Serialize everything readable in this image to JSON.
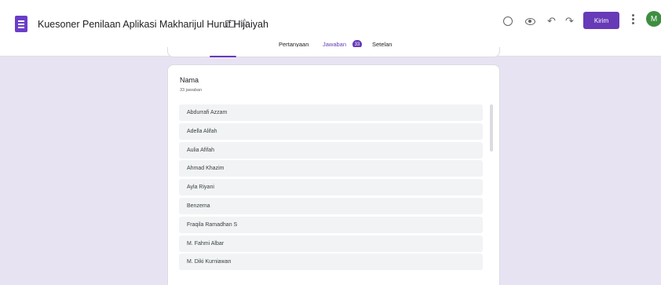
{
  "header": {
    "title": "Kuesoner Penilaan Aplikasi Makharijul Huruf Hijaiyah",
    "send_label": "Kirim",
    "avatar_letter": "M",
    "icons": [
      "folder-icon",
      "star-icon",
      "palette-icon",
      "eye-icon",
      "undo-icon",
      "redo-icon",
      "more-vert-icon"
    ]
  },
  "tabs": {
    "questions": "Pertanyaan",
    "responses": "Jawaban",
    "responses_badge": "33",
    "settings": "Setelan",
    "active": "responses"
  },
  "question": {
    "title": "Nama",
    "count": "33 jawaban",
    "answers": [
      "Abdurrafi Azzam",
      "Adella Alifah",
      "Aulia Afifah",
      "Ahmad Khazim",
      "Ayla Riyani",
      "Benzema",
      "Fraqila Ramadhan S",
      "M. Fahmi Albar",
      "M. Diki Kurniawan"
    ]
  },
  "colors": {
    "accent": "#673ab7",
    "background": "#e8e3f3",
    "avatar": "#3e8e41"
  }
}
